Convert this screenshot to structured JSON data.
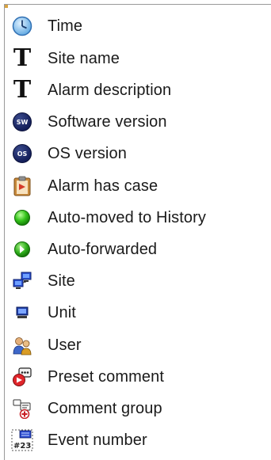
{
  "menu": {
    "items": [
      {
        "label": "Time",
        "icon": "clock-icon"
      },
      {
        "label": "Site name",
        "icon": "text-t-icon"
      },
      {
        "label": "Alarm description",
        "icon": "text-t-icon"
      },
      {
        "label": "Software version",
        "icon": "sw-badge-icon"
      },
      {
        "label": "OS version",
        "icon": "os-badge-icon"
      },
      {
        "label": "Alarm has case",
        "icon": "case-clipboard-icon"
      },
      {
        "label": "Auto-moved to History",
        "icon": "green-dot-icon"
      },
      {
        "label": "Auto-forwarded",
        "icon": "green-forward-icon"
      },
      {
        "label": "Site",
        "icon": "network-computers-icon"
      },
      {
        "label": "Unit",
        "icon": "computer-unit-icon"
      },
      {
        "label": "User",
        "icon": "users-icon"
      },
      {
        "label": "Preset comment",
        "icon": "preset-comment-icon"
      },
      {
        "label": "Comment group",
        "icon": "comment-group-icon"
      },
      {
        "label": "Event number",
        "icon": "event-number-icon"
      }
    ],
    "badge_text": {
      "sw": "SW",
      "os": "OS",
      "event": "#23"
    }
  }
}
